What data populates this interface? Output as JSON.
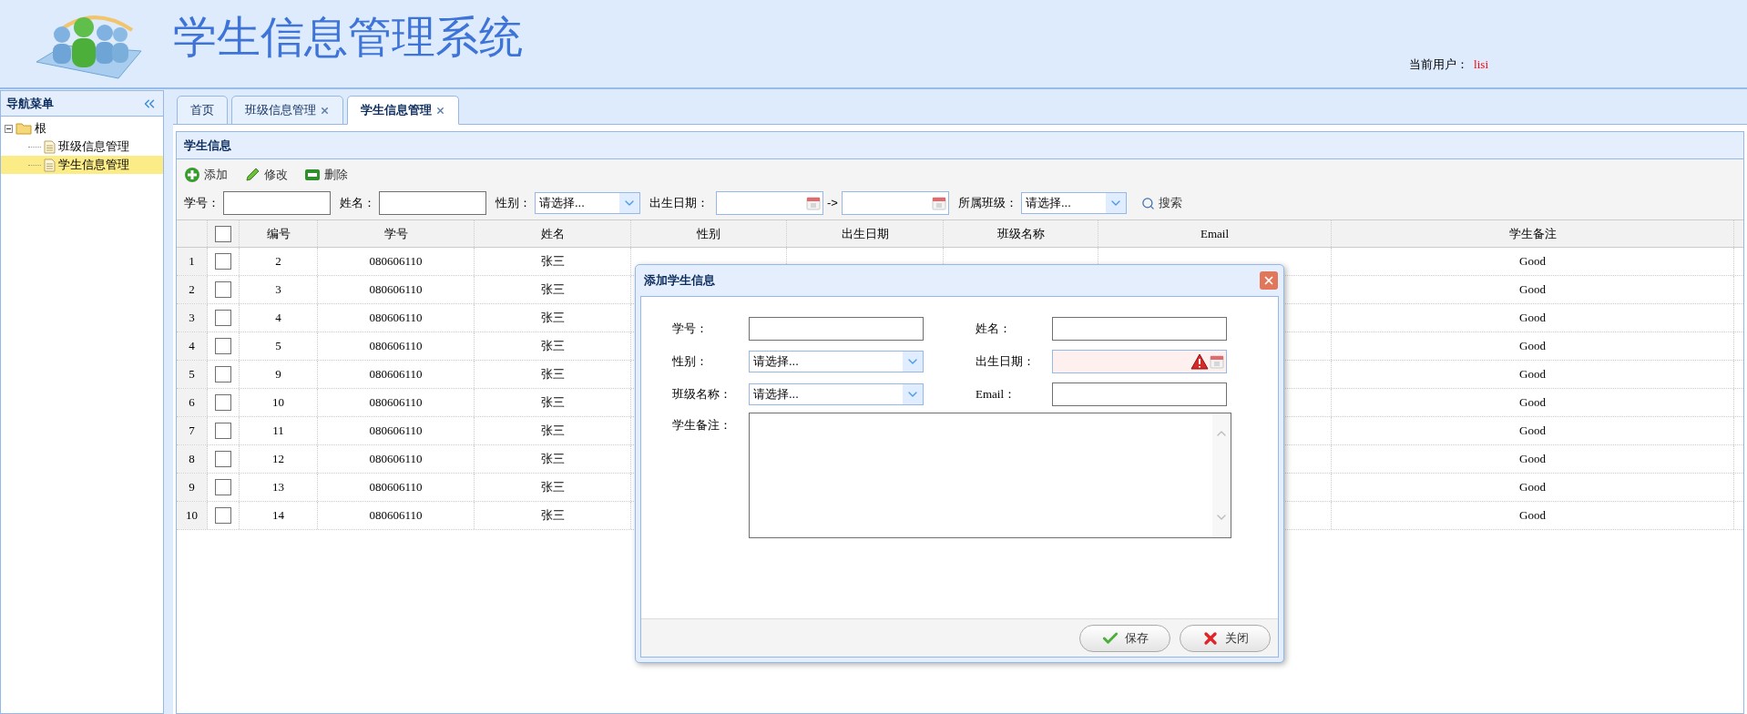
{
  "header": {
    "title": "学生信息管理系统",
    "user_label": "当前用户：",
    "user": "lisi"
  },
  "nav": {
    "title": "导航菜单",
    "tree": [
      {
        "label": "根",
        "expanded": true,
        "selected": false,
        "children": [
          {
            "label": "班级信息管理",
            "selected": false
          },
          {
            "label": "学生信息管理",
            "selected": true
          }
        ]
      }
    ]
  },
  "tabs": [
    {
      "label": "首页",
      "closable": false,
      "selected": false
    },
    {
      "label": "班级信息管理",
      "closable": true,
      "selected": false
    },
    {
      "label": "学生信息管理",
      "closable": true,
      "selected": true
    }
  ],
  "panel": {
    "title": "学生信息",
    "toolbar": [
      {
        "label": "添加",
        "kind": "add"
      },
      {
        "label": "修改",
        "kind": "edit"
      },
      {
        "label": "删除",
        "kind": "remove"
      }
    ],
    "search": [
      {
        "label": "学号：",
        "kind": "text"
      },
      {
        "label": "姓名：",
        "kind": "text"
      },
      {
        "label": "性别：",
        "kind": "select",
        "value": "请选择..."
      },
      {
        "label": "出生日期：",
        "kind": "daterange",
        "separator": "->"
      },
      {
        "label": "所属班级：",
        "kind": "select",
        "value": "请选择..."
      }
    ],
    "search_button": "搜索"
  },
  "table": {
    "header_checked": false,
    "columns": [
      "编号",
      "学号",
      "姓名",
      "性别",
      "出生日期",
      "班级名称",
      "Email",
      "学生备注"
    ],
    "rows": [
      {
        "index": "1",
        "checked": false,
        "id": "2",
        "student_no": "080606110",
        "name": "张三",
        "remark": "Good"
      },
      {
        "index": "2",
        "checked": false,
        "id": "3",
        "student_no": "080606110",
        "name": "张三",
        "remark": "Good"
      },
      {
        "index": "3",
        "checked": false,
        "id": "4",
        "student_no": "080606110",
        "name": "张三",
        "remark": "Good"
      },
      {
        "index": "4",
        "checked": false,
        "id": "5",
        "student_no": "080606110",
        "name": "张三",
        "remark": "Good"
      },
      {
        "index": "5",
        "checked": false,
        "id": "9",
        "student_no": "080606110",
        "name": "张三",
        "remark": "Good"
      },
      {
        "index": "6",
        "checked": false,
        "id": "10",
        "student_no": "080606110",
        "name": "张三",
        "remark": "Good"
      },
      {
        "index": "7",
        "checked": false,
        "id": "11",
        "student_no": "080606110",
        "name": "张三",
        "remark": "Good"
      },
      {
        "index": "8",
        "checked": false,
        "id": "12",
        "student_no": "080606110",
        "name": "张三",
        "remark": "Good"
      },
      {
        "index": "9",
        "checked": false,
        "id": "13",
        "student_no": "080606110",
        "name": "张三",
        "remark": "Good"
      },
      {
        "index": "10",
        "checked": false,
        "id": "14",
        "student_no": "080606110",
        "name": "张三",
        "remark": "Good"
      }
    ]
  },
  "dialog": {
    "title": "添加学生信息",
    "fields": [
      {
        "label": "学号：",
        "kind": "text"
      },
      {
        "label": "姓名：",
        "kind": "text"
      },
      {
        "label": "性别：",
        "kind": "select",
        "value": "请选择..."
      },
      {
        "label": "出生日期：",
        "kind": "date",
        "invalid": true
      },
      {
        "label": "班级名称：",
        "kind": "select",
        "value": "请选择..."
      },
      {
        "label": "Email：",
        "kind": "text"
      }
    ],
    "remark_label": "学生备注：",
    "buttons": [
      {
        "label": "保存",
        "kind": "save"
      },
      {
        "label": "关闭",
        "kind": "close"
      }
    ]
  }
}
